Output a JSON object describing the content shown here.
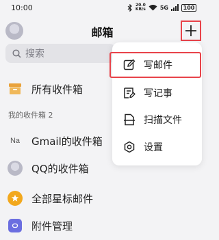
{
  "statusbar": {
    "time": "10:00",
    "net_speed_value": "20.0",
    "net_speed_unit": "KB/s",
    "signal_label": "5G",
    "battery": "100"
  },
  "header": {
    "title": "邮箱"
  },
  "search": {
    "placeholder": "搜索"
  },
  "inbox_all": {
    "label": "所有收件箱"
  },
  "section": {
    "label": "我的收件箱 2"
  },
  "accounts": [
    {
      "prefix": "Na",
      "label": "Gmail的收件箱"
    },
    {
      "label": "QQ的收件箱"
    }
  ],
  "starred": {
    "label": "全部星标邮件"
  },
  "attachments": {
    "label": "附件管理"
  },
  "menu": {
    "items": [
      {
        "label": "写邮件",
        "icon": "compose-icon"
      },
      {
        "label": "写记事",
        "icon": "note-icon"
      },
      {
        "label": "扫描文件",
        "icon": "scan-file-icon"
      },
      {
        "label": "设置",
        "icon": "gear-icon"
      }
    ]
  },
  "colors": {
    "highlight": "#e8434a",
    "inbox_icon": "#e9a23b",
    "star": "#f2a81d",
    "attachment": "#6b6ee0"
  }
}
